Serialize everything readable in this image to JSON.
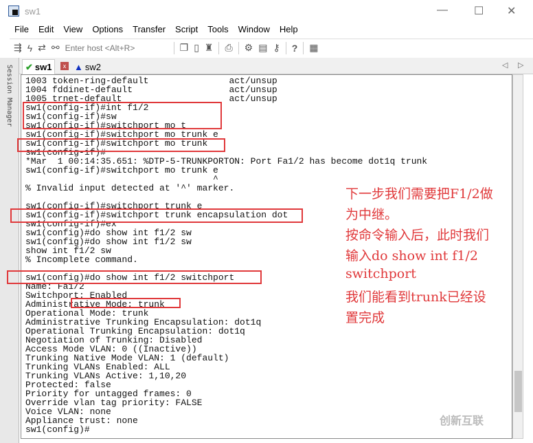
{
  "window": {
    "title": "sw1"
  },
  "menu": [
    "File",
    "Edit",
    "View",
    "Options",
    "Transfer",
    "Script",
    "Tools",
    "Window",
    "Help"
  ],
  "toolbar": {
    "host_placeholder": "Enter host <Alt+R>"
  },
  "tabs": [
    {
      "label": "sw1",
      "status": "connected"
    },
    {
      "label": "sw2",
      "status": "warning"
    }
  ],
  "sidebar": {
    "label": "Session Manager"
  },
  "terminal": {
    "lines": [
      "1003 token-ring-default               act/unsup",
      "1004 fddinet-default                  act/unsup",
      "1005 trnet-default                    act/unsup",
      "sw1(config-if)#int f1/2",
      "sw1(config-if)#sw",
      "sw1(config-if)#switchport mo t",
      "sw1(config-if)#switchport mo trunk e",
      "sw1(config-if)#switchport mo trunk",
      "sw1(config-if)#",
      "*Mar  1 00:14:35.651: %DTP-5-TRUNKPORTON: Port Fa1/2 has become dot1q trunk",
      "sw1(config-if)#switchport mo trunk e",
      "                                   ^",
      "% Invalid input detected at '^' marker.",
      "",
      "sw1(config-if)#switchport trunk e",
      "sw1(config-if)#switchport trunk encapsulation dot",
      "sw1(config-if)#ex",
      "sw1(config)#do show int f1/2 sw",
      "sw1(config)#do show int f1/2 sw",
      "show int f1/2 sw",
      "% Incomplete command.",
      "",
      "sw1(config)#do show int f1/2 switchport",
      "Name: Fa1/2",
      "Switchport: Enabled",
      "Administrative Mode: trunk",
      "Operational Mode: trunk",
      "Administrative Trunking Encapsulation: dot1q",
      "Operational Trunking Encapsulation: dot1q",
      "Negotiation of Trunking: Disabled",
      "Access Mode VLAN: 0 ((Inactive))",
      "Trunking Native Mode VLAN: 1 (default)",
      "Trunking VLANs Enabled: ALL",
      "Trunking VLANs Active: 1,10,20",
      "Protected: false",
      "Priority for untagged frames: 0",
      "Override vlan tag priority: FALSE",
      "Voice VLAN: none",
      "Appliance trust: none",
      "sw1(config)#"
    ]
  },
  "annotation": [
    "下一步我们需要把F1/2做",
    "为中继。",
    "按命令输入后，此时我们",
    "输入do show int f1/2",
    "switchport",
    "我们能看到trunk已经设",
    "置完成"
  ],
  "watermark": "创新互联",
  "colors": {
    "highlight": "#e0383a"
  }
}
